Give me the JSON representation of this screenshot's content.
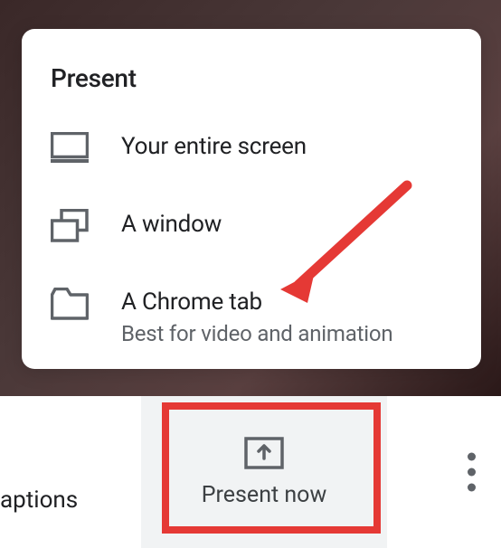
{
  "popup": {
    "title": "Present",
    "options": [
      {
        "label": "Your entire screen",
        "sublabel": null
      },
      {
        "label": "A window",
        "sublabel": null
      },
      {
        "label": "A Chrome tab",
        "sublabel": "Best for video and animation"
      }
    ]
  },
  "toolbar": {
    "captions_partial": "aptions",
    "present_now_label": "Present now"
  },
  "annotation": {
    "arrow_color": "#e53935",
    "highlight_box_color": "#e53935"
  }
}
